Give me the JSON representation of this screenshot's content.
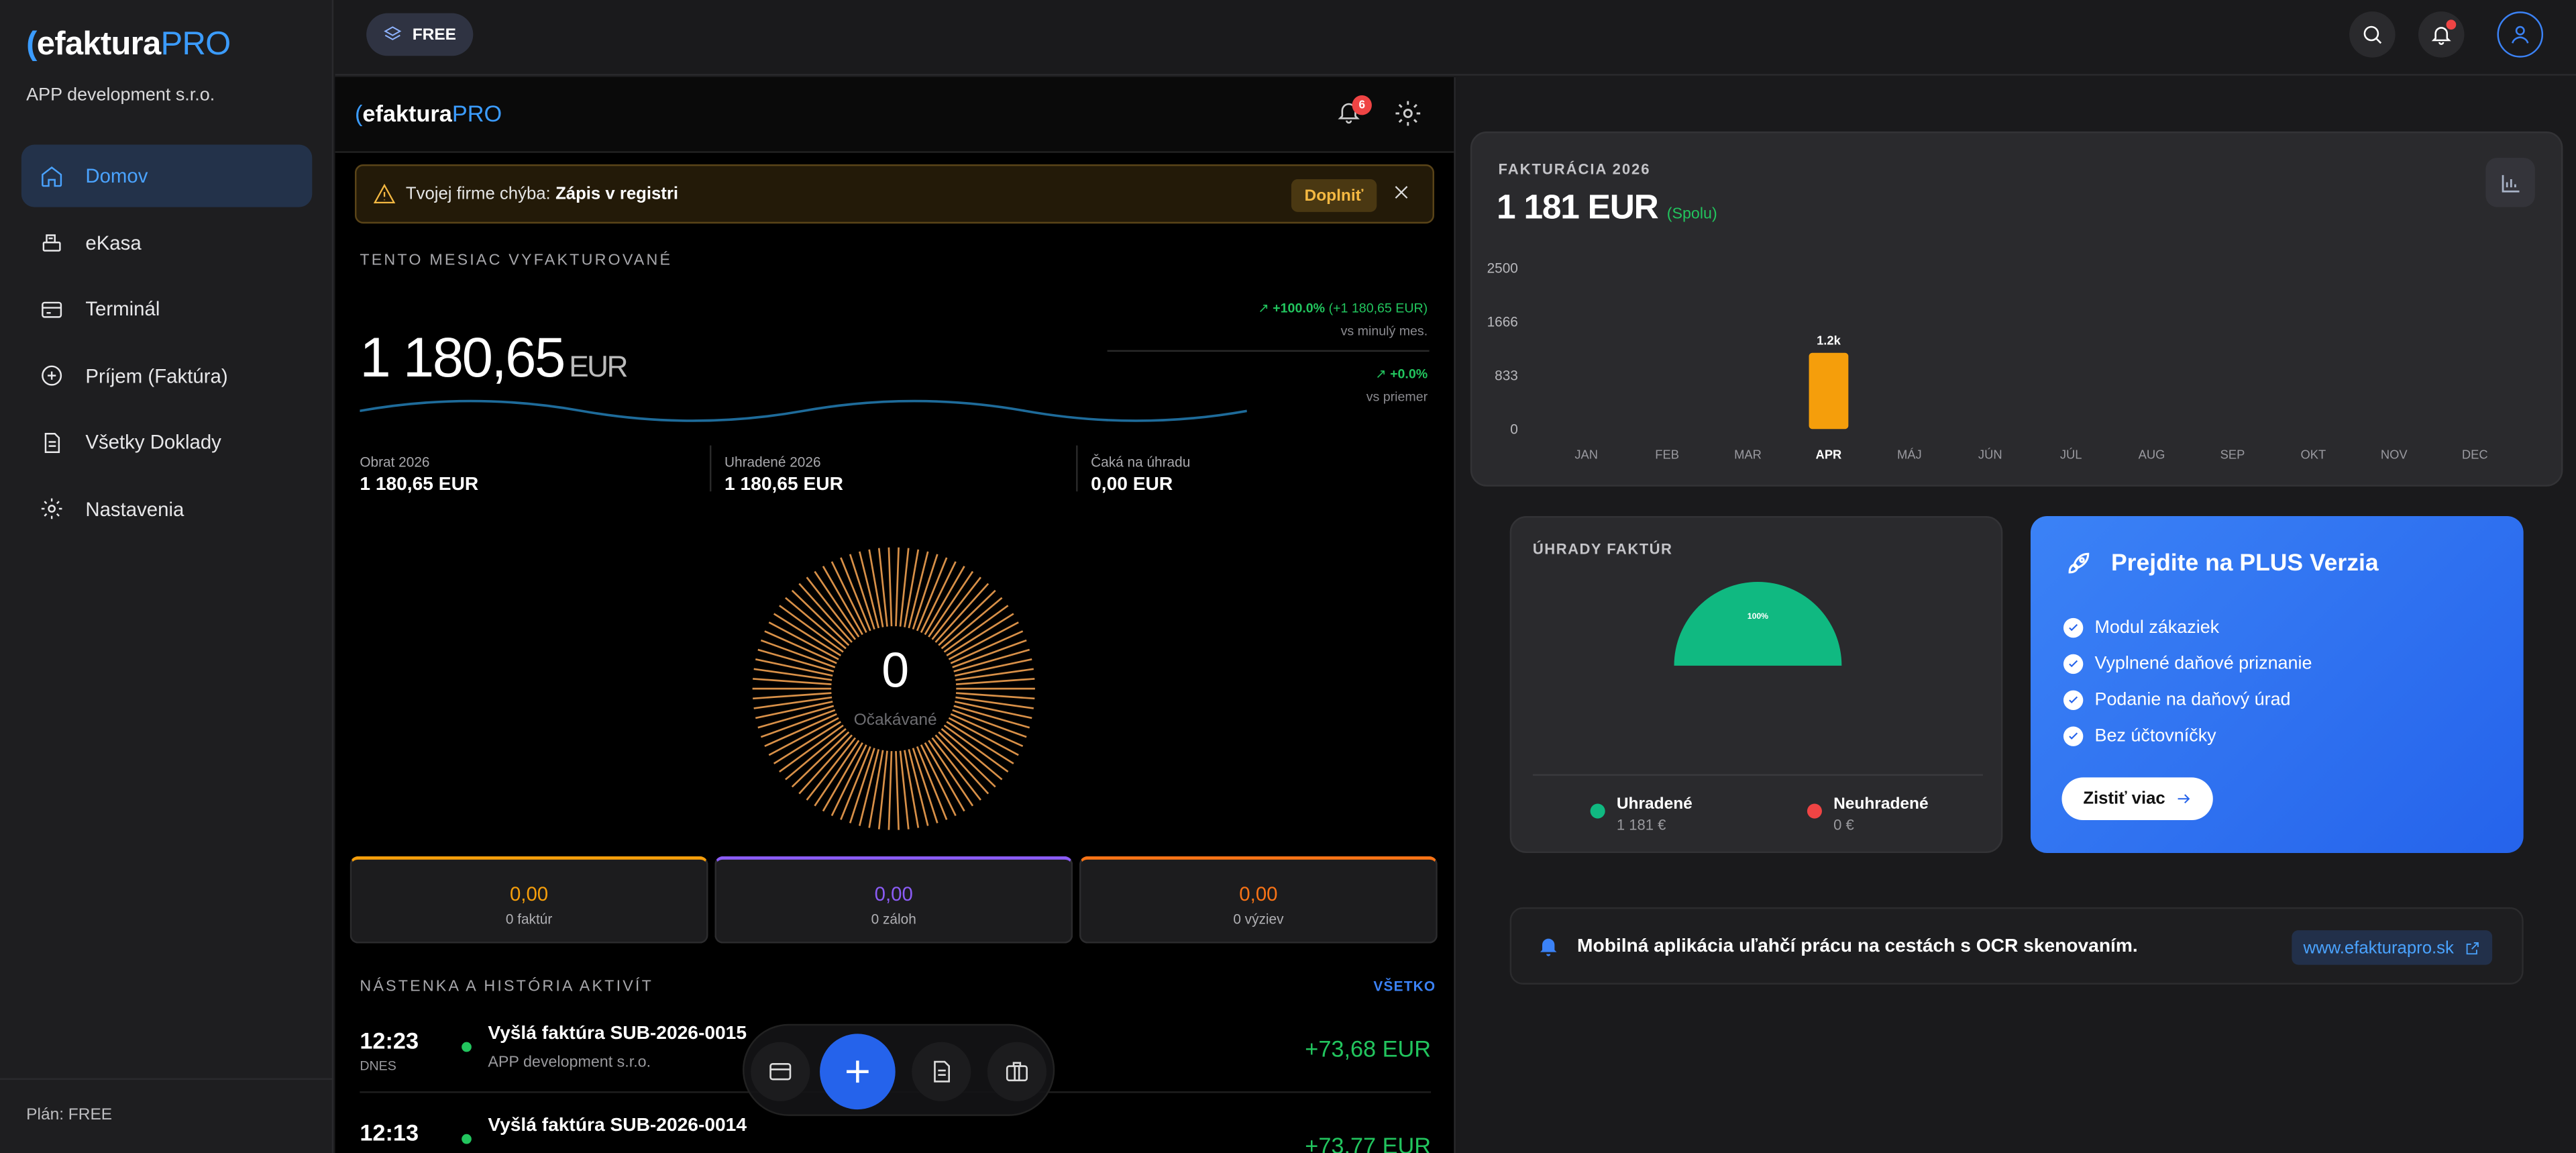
{
  "sidebar": {
    "logo_main": "efaktura",
    "logo_pro": "PRO",
    "company": "APP development s.r.o.",
    "items": [
      {
        "label": "Domov",
        "icon": "home-icon"
      },
      {
        "label": "eKasa",
        "icon": "register-icon"
      },
      {
        "label": "Terminál",
        "icon": "card-icon"
      },
      {
        "label": "Príjem (Faktúra)",
        "icon": "plus-circle-icon"
      },
      {
        "label": "Všetky Doklady",
        "icon": "document-icon"
      },
      {
        "label": "Nastavenia",
        "icon": "gear-icon"
      }
    ],
    "plan": "Plán: FREE"
  },
  "topbar": {
    "free_label": "FREE"
  },
  "mid": {
    "logo_main": "efaktura",
    "logo_pro": "PRO",
    "notif_count": "6",
    "alert_text": "Tvojej firme chýba:",
    "alert_bold": "Zápis v registri",
    "alert_button": "Doplniť",
    "month_title": "TENTO MESIAC VYFAKTUROVANÉ",
    "amount": "1 180,65",
    "currency": "EUR",
    "trend1_pct": "+100.0%",
    "trend1_abs": "(+1 180,65 EUR)",
    "trend1_sub": "vs minulý mes.",
    "trend2_pct": "+0.0%",
    "trend2_sub": "vs priemer",
    "stats": [
      {
        "label": "Obrat 2026",
        "value": "1 180,65 EUR"
      },
      {
        "label": "Uhradené 2026",
        "value": "1 180,65 EUR"
      },
      {
        "label": "Čaká na úhradu",
        "value": "0,00 EUR"
      }
    ],
    "expected_value": "0",
    "expected_label": "Očakávané",
    "cards": [
      {
        "value": "0,00",
        "label": "0 faktúr",
        "color": "#f59e0b"
      },
      {
        "value": "0,00",
        "label": "0 záloh",
        "color": "#8b5cf6"
      },
      {
        "value": "0,00",
        "label": "0 výziev",
        "color": "#f97316"
      }
    ],
    "activity_title": "NÁSTENKA A HISTÓRIA AKTIVÍT",
    "activity_all": "VŠETKO",
    "activities": [
      {
        "time": "12:23",
        "day": "DNES",
        "name": "Vyšlá faktúra SUB-2026-0015",
        "sub": "APP development s.r.o.",
        "amount": "+73,68 EUR"
      },
      {
        "time": "12:13",
        "day": "",
        "name": "Vyšlá faktúra SUB-2026-0014",
        "sub": "",
        "amount": "+73,77 EUR"
      }
    ]
  },
  "right": {
    "fakt_title": "FAKTURÁCIA 2026",
    "fakt_total": "1 181 EUR",
    "fakt_spolu": "(Spolu)",
    "uhrady_title": "ÚHRADY FAKTÚR",
    "legend": [
      {
        "label": "Uhradené",
        "value": "1 181 €",
        "color": "#10b981"
      },
      {
        "label": "Neuhradené",
        "value": "0 €",
        "color": "#ef4444"
      }
    ],
    "plus_title": "Prejdite na PLUS Verzia",
    "plus_items": [
      "Modul zákaziek",
      "Vyplnené daňové priznanie",
      "Podanie na daňový úrad",
      "Bez účtovníčky"
    ],
    "plus_button": "Zistiť viac",
    "mobile_text": "Mobilná aplikácia uľahčí prácu na cestách s OCR skenovaním.",
    "mobile_link": "www.efakturapro.sk"
  },
  "chart_data": [
    {
      "type": "bar",
      "title": "FAKTURÁCIA 2026",
      "categories": [
        "JAN",
        "FEB",
        "MAR",
        "APR",
        "MÁJ",
        "JÚN",
        "JÚL",
        "AUG",
        "SEP",
        "OKT",
        "NOV",
        "DEC"
      ],
      "values": [
        0,
        0,
        0,
        1181,
        0,
        0,
        0,
        0,
        0,
        0,
        0,
        0
      ],
      "data_labels": {
        "APR": "1.2k"
      },
      "yticks": [
        0,
        833,
        1666,
        2500
      ],
      "ylim": [
        0,
        2500
      ],
      "highlight": "APR",
      "bar_color": "#f59e0b"
    },
    {
      "type": "pie",
      "title": "ÚHRADY FAKTÚR",
      "style": "half-donut",
      "slices": [
        {
          "name": "Uhradené",
          "value": 1181,
          "label": "100%",
          "color": "#10b981"
        },
        {
          "name": "Neuhradené",
          "value": 0,
          "color": "#ef4444"
        }
      ]
    }
  ]
}
